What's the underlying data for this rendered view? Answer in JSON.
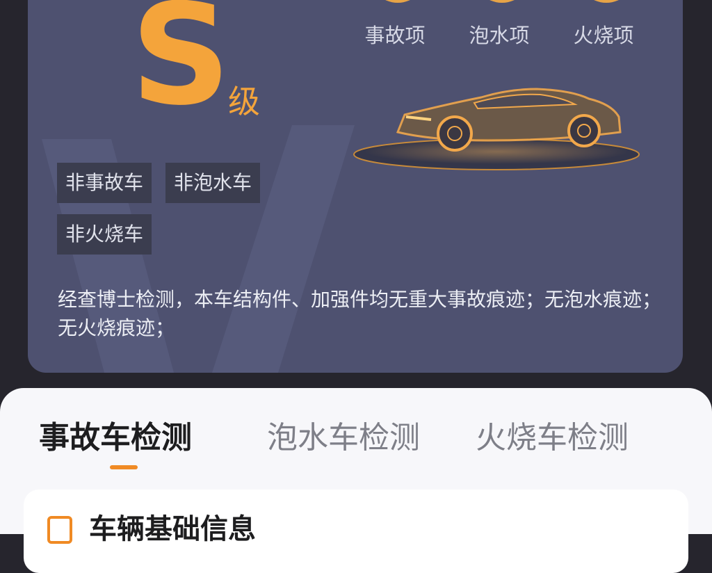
{
  "report": {
    "grade_letter": "S",
    "grade_suffix": "级",
    "gauges": [
      {
        "label": "事故项"
      },
      {
        "label": "泡水项"
      },
      {
        "label": "火烧项"
      }
    ],
    "tags": [
      "非事故车",
      "非泡水车",
      "非火烧车"
    ],
    "summary": "经查博士检测，本车结构件、加强件均无重大事故痕迹；无泡水痕迹；无火烧痕迹；",
    "accent_color": "#f4a43b"
  },
  "tabs": [
    {
      "label": "事故车检测",
      "active": true
    },
    {
      "label": "泡水车检测",
      "active": false
    },
    {
      "label": "火烧车检测",
      "active": false
    }
  ],
  "info_section": {
    "title": "车辆基础信息",
    "icon": "document-icon"
  }
}
